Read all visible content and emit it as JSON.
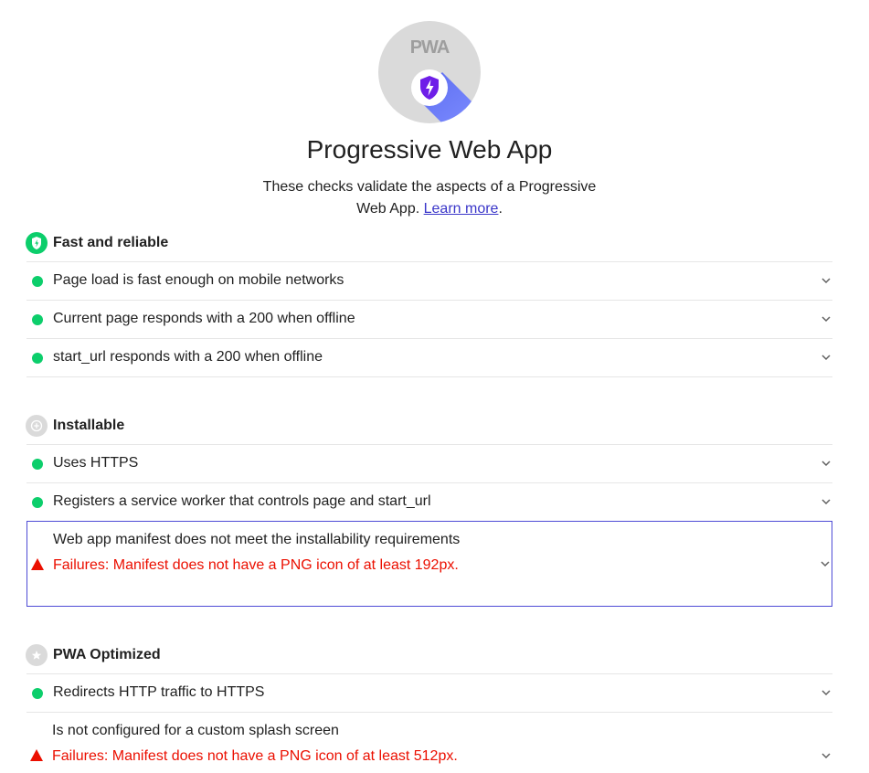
{
  "header": {
    "badge_text": "PWA",
    "title": "Progressive Web App",
    "description_line1": "These checks validate the aspects of a Progressive",
    "description_line2": "Web App.",
    "learn_more": "Learn more",
    "period": "."
  },
  "colors": {
    "pass": "#0cce6b",
    "fail": "#eb0f00",
    "focus_border": "#4e4bd6",
    "link": "#3a36c9"
  },
  "groups": [
    {
      "title": "Fast and reliable",
      "icon": "lightning-bolt-icon",
      "audits": [
        {
          "title": "Page load is fast enough on mobile networks",
          "status": "pass"
        },
        {
          "title": "Current page responds with a 200 when offline",
          "status": "pass"
        },
        {
          "title": "start_url responds with a 200 when offline",
          "status": "pass"
        }
      ]
    },
    {
      "title": "Installable",
      "icon": "plus-icon",
      "audits": [
        {
          "title": "Uses HTTPS",
          "status": "pass"
        },
        {
          "title": "Registers a service worker that controls page and start_url",
          "status": "pass"
        },
        {
          "title": "Web app manifest does not meet the installability requirements",
          "status": "fail",
          "message": "Failures: Manifest does not have a PNG icon of at least 192px."
        }
      ]
    },
    {
      "title": "PWA Optimized",
      "icon": "star-icon",
      "audits": [
        {
          "title": "Redirects HTTP traffic to HTTPS",
          "status": "pass"
        },
        {
          "title": "Is not configured for a custom splash screen",
          "status": "fail",
          "message": "Failures: Manifest does not have a PNG icon of at least 512px."
        }
      ]
    }
  ]
}
